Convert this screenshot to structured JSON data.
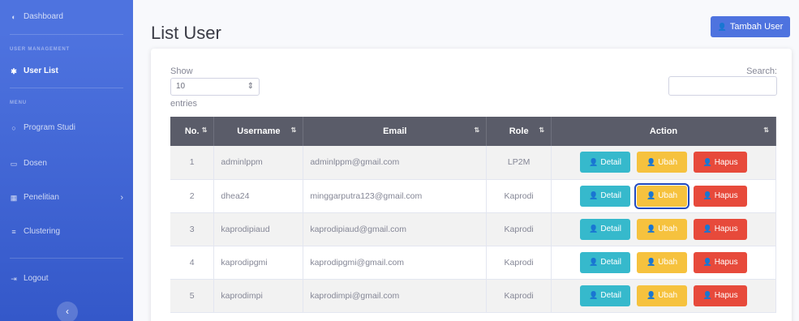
{
  "sidebar": {
    "dashboard": "Dashboard",
    "heading_user": "USER MANAGEMENT",
    "user_list": "User List",
    "heading_menu": "MENU",
    "program_studi": "Program Studi",
    "dosen": "Dosen",
    "penelitian": "Penelitian",
    "clustering": "Clustering",
    "logout": "Logout",
    "toggle": "‹"
  },
  "page": {
    "title": "List User",
    "add_button": "Tambah User"
  },
  "table_controls": {
    "show_label": "Show",
    "entries_value": "10",
    "entries_label": "entries",
    "search_label": "Search:"
  },
  "table": {
    "headers": [
      "No.",
      "Username",
      "Email",
      "Role",
      "Action"
    ],
    "rows": [
      {
        "no": "1",
        "username": "adminlppm",
        "email": "adminlppm@gmail.com",
        "role": "LP2M"
      },
      {
        "no": "2",
        "username": "dhea24",
        "email": "minggarputra123@gmail.com",
        "role": "Kaprodi"
      },
      {
        "no": "3",
        "username": "kaprodipiaud",
        "email": "kaprodipiaud@gmail.com",
        "role": "Kaprodi"
      },
      {
        "no": "4",
        "username": "kaprodipgmi",
        "email": "kaprodipgmi@gmail.com",
        "role": "Kaprodi"
      },
      {
        "no": "5",
        "username": "kaprodimpi",
        "email": "kaprodimpi@gmail.com",
        "role": "Kaprodi"
      }
    ],
    "buttons": {
      "detail": "Detail",
      "ubah": "Ubah",
      "hapus": "Hapus"
    }
  },
  "colors": {
    "primary": "#4e73df",
    "info": "#36b9cc",
    "warning": "#f6c23e",
    "danger": "#e74a3b",
    "header": "#5a5c69"
  }
}
